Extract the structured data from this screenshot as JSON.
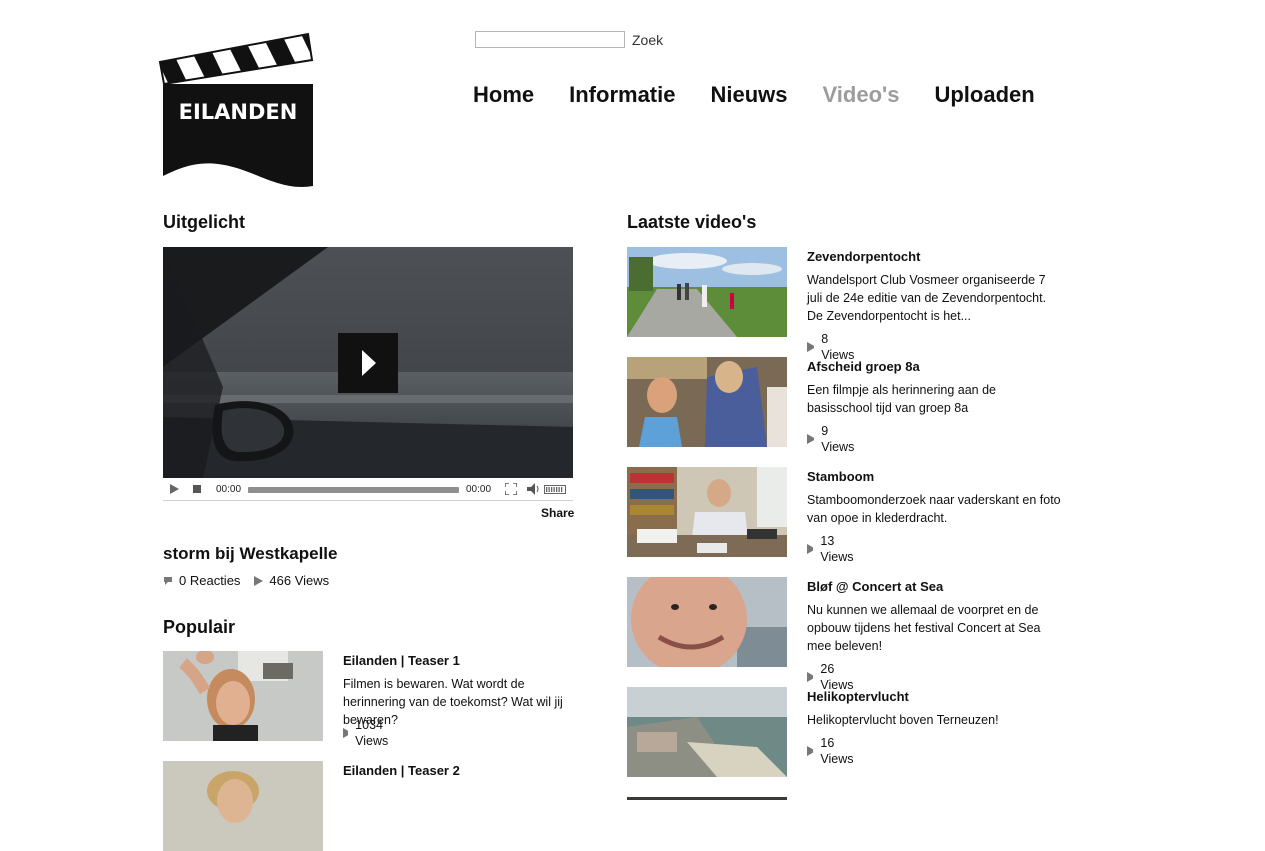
{
  "brand": {
    "logo_text": "EILANDEN"
  },
  "search": {
    "value": "",
    "placeholder": "",
    "button_label": "Zoek"
  },
  "nav": [
    {
      "label": "Home",
      "active": false
    },
    {
      "label": "Informatie",
      "active": false
    },
    {
      "label": "Nieuws",
      "active": false
    },
    {
      "label": "Video's",
      "active": true
    },
    {
      "label": "Uploaden",
      "active": false
    }
  ],
  "featured": {
    "heading": "Uitgelicht",
    "player": {
      "current_time": "00:00",
      "duration": "00:00",
      "share_label": "Share"
    },
    "title": "storm bij Westkapelle",
    "reactions": "0 Reacties",
    "views": "466 Views"
  },
  "popular": {
    "heading": "Populair",
    "items": [
      {
        "title": "Eilanden | Teaser 1",
        "description": "Filmen is bewaren. Wat wordt de herinnering van de toekomst? Wat wil jij bewaren?",
        "views": "1034 Views"
      },
      {
        "title": "Eilanden | Teaser 2",
        "description": "",
        "views": ""
      }
    ]
  },
  "latest": {
    "heading": "Laatste video's",
    "items": [
      {
        "title": "Zevendorpentocht",
        "description": "Wandelsport Club Vosmeer organiseerde 7 juli de 24e editie van de Zevendorpentocht. De Zevendorpentocht is het...",
        "views": "8 Views"
      },
      {
        "title": "Afscheid groep 8a",
        "description": "Een filmpje als herinnering aan de basisschool tijd van groep 8a",
        "views": "9 Views"
      },
      {
        "title": "Stamboom",
        "description": "Stamboomonderzoek naar vaderskant en foto van opoe in klederdracht.",
        "views": "13 Views"
      },
      {
        "title": "Bløf @ Concert at Sea",
        "description": "Nu kunnen we allemaal de voorpret en de opbouw tijdens het festival Concert at Sea mee beleven!",
        "views": "26 Views"
      },
      {
        "title": "Helikoptervlucht",
        "description": "Helikoptervlucht boven Terneuzen!",
        "views": "16 Views"
      }
    ]
  },
  "icons": {
    "play": "play-icon",
    "stop": "stop-icon",
    "fullscreen": "fullscreen-icon",
    "volume": "volume-icon",
    "comment": "comment-icon",
    "views": "views-play-icon"
  },
  "colors": {
    "nav_active": "#9c9c9c",
    "text": "#111111",
    "player_bg": "#3b3f44"
  }
}
